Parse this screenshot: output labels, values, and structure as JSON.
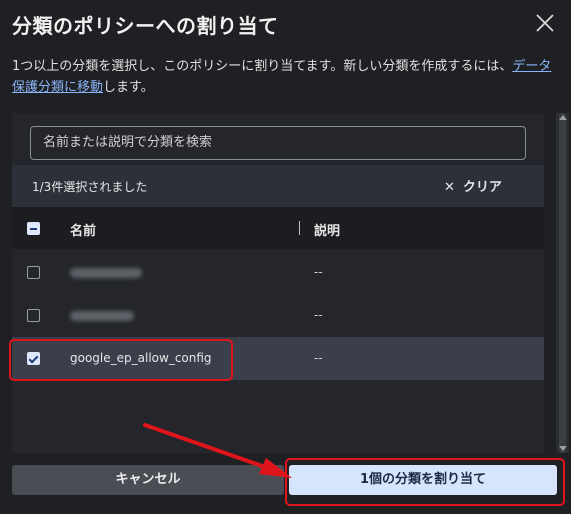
{
  "dialog": {
    "title": "分類のポリシーへの割り当て",
    "description_prefix": "1つ以上の分類を選択し、このポリシーに割り当てます。新しい分類を作成するには、",
    "description_link": "データ保護分類に移動",
    "description_suffix": "します。"
  },
  "search": {
    "placeholder": "名前または説明で分類を検索"
  },
  "selection": {
    "count_text": "1/3件選択されました",
    "clear_label": "クリア"
  },
  "table": {
    "columns": {
      "name": "名前",
      "description": "説明"
    },
    "rows": [
      {
        "name": "",
        "description": "--",
        "checked": false,
        "redacted": true
      },
      {
        "name": "",
        "description": "--",
        "checked": false,
        "redacted": true
      },
      {
        "name": "google_ep_allow_config",
        "description": "--",
        "checked": true,
        "redacted": false
      }
    ]
  },
  "footer": {
    "cancel_label": "キャンセル",
    "assign_label": "1個の分類を割り当て"
  },
  "colors": {
    "highlight": "#e0151b",
    "primary_button": "#d6e4fc",
    "link": "#8ab4f8"
  }
}
